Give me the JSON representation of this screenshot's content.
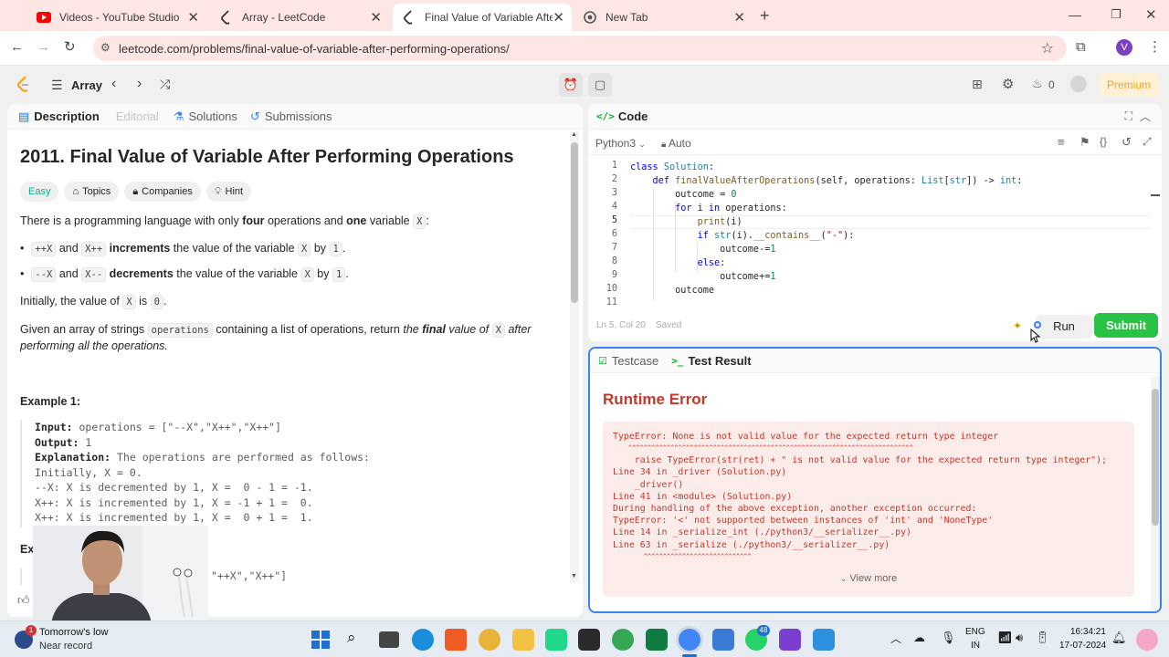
{
  "browser": {
    "tabs": [
      {
        "title": "Videos - YouTube Studio",
        "icon": "youtube-icon"
      },
      {
        "title": "Array - LeetCode",
        "icon": "leetcode-icon"
      },
      {
        "title": "Final Value of Variable After Per",
        "icon": "leetcode-icon"
      },
      {
        "title": "New Tab",
        "icon": "chrome-icon"
      }
    ],
    "url": "leetcode.com/problems/final-value-of-variable-after-performing-operations/",
    "profile_initial": "V"
  },
  "nav": {
    "list_label": "Array",
    "streak_count": "0",
    "premium_label": "Premium"
  },
  "left_tabs": {
    "description": "Description",
    "editorial": "Editorial",
    "solutions": "Solutions",
    "submissions": "Submissions"
  },
  "problem": {
    "title": "2011. Final Value of Variable After Performing Operations",
    "difficulty": "Easy",
    "chips": {
      "topics": "Topics",
      "companies": "Companies",
      "hint": "Hint"
    },
    "intro_a": "There is a programming language with only ",
    "intro_b": "four",
    "intro_c": " operations and ",
    "intro_d": "one",
    "intro_e": " variable ",
    "var": "X",
    "intro_f": ":",
    "bullet1": {
      "op1": "++X",
      "and": " and ",
      "op2": "X++",
      "verb": "increments",
      "rest": " the value of the variable ",
      "by": " by ",
      "one": "1",
      "end": "."
    },
    "bullet2": {
      "op1": "--X",
      "and": " and ",
      "op2": "X--",
      "verb": "decrements",
      "rest": " the value of the variable ",
      "by": " by ",
      "one": "1",
      "end": "."
    },
    "initially_a": "Initially, the value of ",
    "initially_b": " is ",
    "initially_zero": "0",
    "initially_c": ".",
    "given_a": "Given an array of strings ",
    "given_code": "operations",
    "given_b": " containing a list of operations, return ",
    "given_c": "the ",
    "given_final": "final",
    "given_d": " value of ",
    "given_e": " after performing all the operations.",
    "example1_title": "Example 1:",
    "example1_input_label": "Input:",
    "example1_input": " operations = [\"--X\",\"X++\",\"X++\"]",
    "example1_output_label": "Output:",
    "example1_output": " 1",
    "example1_expl_label": "Explanation:",
    "example1_expl": " The operations are performed as follows:",
    "example1_lines": [
      "Initially, X = 0.",
      "--X: X is decremented by 1, X =  0 - 1 = -1.",
      "X++: X is incremented by 1, X = -1 + 1 =  0.",
      "X++: X is incremented by 1, X =  0 + 1 =  1."
    ],
    "example2_title_visible": "Exa",
    "example2_input_visible": "\"++X\",\"X++\"]",
    "example2_output_visible": ")"
  },
  "code": {
    "header": "Code",
    "language": "Python3",
    "mode": "Auto",
    "status_pos": "Ln 5, Col 20",
    "status_saved": "Saved",
    "run": "Run",
    "submit": "Submit",
    "line_numbers": [
      "1",
      "2",
      "3",
      "4",
      "5",
      "6",
      "7",
      "8",
      "9",
      "10",
      "11"
    ]
  },
  "result": {
    "tab_testcase": "Testcase",
    "tab_result": "Test Result",
    "title": "Runtime Error",
    "error_lines": [
      "TypeError: None is not valid value for the expected return type integer",
      "    ^^^^^^^^^^^^^^^^^^^^^^^^^^^^^^^^^^^^^^^^^^^^^^^^^^^^^^^^^^^^^^^^^^^^^^^^^^",
      "    raise TypeError(str(ret) + \" is not valid value for the expected return type integer\");",
      "Line 34 in _driver (Solution.py)",
      "    _driver()",
      "Line 41 in <module> (Solution.py)",
      "During handling of the above exception, another exception occurred:",
      "TypeError: '<' not supported between instances of 'int' and 'NoneType'",
      "Line 14 in _serialize_int (./python3/__serializer__.py)",
      "Line 63 in _serialize (./python3/__serializer__.py)",
      "        ^^^^^^^^^^^^^^^^^^^^^^^^^^^^"
    ],
    "view_more": "View more"
  },
  "taskbar": {
    "weather_line1": "Tomorrow's low",
    "weather_line2": "Near record",
    "weather_badge": "1",
    "lang_line1": "ENG",
    "lang_line2": "IN",
    "time": "16:34:21",
    "date": "17-07-2024",
    "whatsapp_badge": "48"
  },
  "colors": {
    "accent_orange": "#ffa116",
    "easy_green": "#00af9b",
    "submit_green": "#28c244",
    "error_red": "#c0392b",
    "focus_blue": "#3b82f6"
  }
}
